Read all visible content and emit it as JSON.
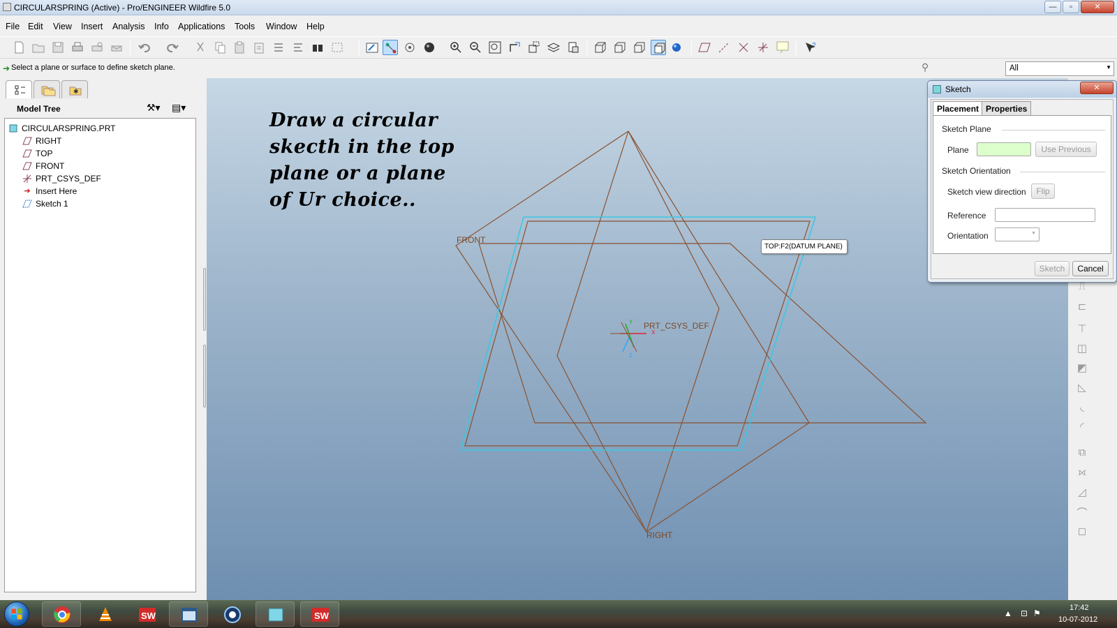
{
  "window": {
    "title": "CIRCULARSPRING (Active) - Pro/ENGINEER Wildfire 5.0"
  },
  "menu": [
    "File",
    "Edit",
    "View",
    "Insert",
    "Analysis",
    "Info",
    "Applications",
    "Tools",
    "Window",
    "Help"
  ],
  "message": "Select a plane or surface to define sketch plane.",
  "filter": {
    "value": "All"
  },
  "navigator": {
    "title": "Model Tree",
    "items": [
      {
        "label": "CIRCULARSPRING.PRT",
        "icon": "part-icon"
      },
      {
        "label": "RIGHT",
        "icon": "datum-plane-icon"
      },
      {
        "label": "TOP",
        "icon": "datum-plane-icon"
      },
      {
        "label": "FRONT",
        "icon": "datum-plane-icon"
      },
      {
        "label": "PRT_CSYS_DEF",
        "icon": "csys-icon"
      },
      {
        "label": "Insert Here",
        "icon": "insert-arrow-icon"
      },
      {
        "label": "Sketch 1",
        "icon": "sketch-icon"
      }
    ]
  },
  "graphics": {
    "callout": [
      "Draw a circular",
      "skecth in the top",
      "plane or a plane",
      "of Ur choice.."
    ],
    "plane_labels": {
      "front": "FRONT",
      "right": "RIGHT",
      "csys": "PRT_CSYS_DEF"
    },
    "csys_axes": {
      "x": "X",
      "y": "Y",
      "z": "Z"
    },
    "tooltip": "TOP:F2(DATUM PLANE)",
    "colors": {
      "datum": "#8a5230",
      "highlight": "#3cc7e0"
    }
  },
  "sketch_dialog": {
    "title": "Sketch",
    "tabs": [
      "Placement",
      "Properties"
    ],
    "sketch_plane_heading": "Sketch Plane",
    "plane_label": "Plane",
    "use_previous": "Use Previous",
    "orientation_heading": "Sketch Orientation",
    "view_direction_label": "Sketch view direction",
    "flip": "Flip",
    "reference_label": "Reference",
    "orientation_label": "Orientation",
    "sketch_button": "Sketch",
    "cancel_button": "Cancel",
    "plane_field_color": "#ddffcc"
  },
  "taskbar": {
    "apps": [
      "chrome-icon",
      "vlc-icon",
      "solidworks-icon",
      "window-icon",
      "camera-icon",
      "proe-icon",
      "solidworks-icon"
    ],
    "time": "17:42",
    "date": "10-07-2012"
  }
}
